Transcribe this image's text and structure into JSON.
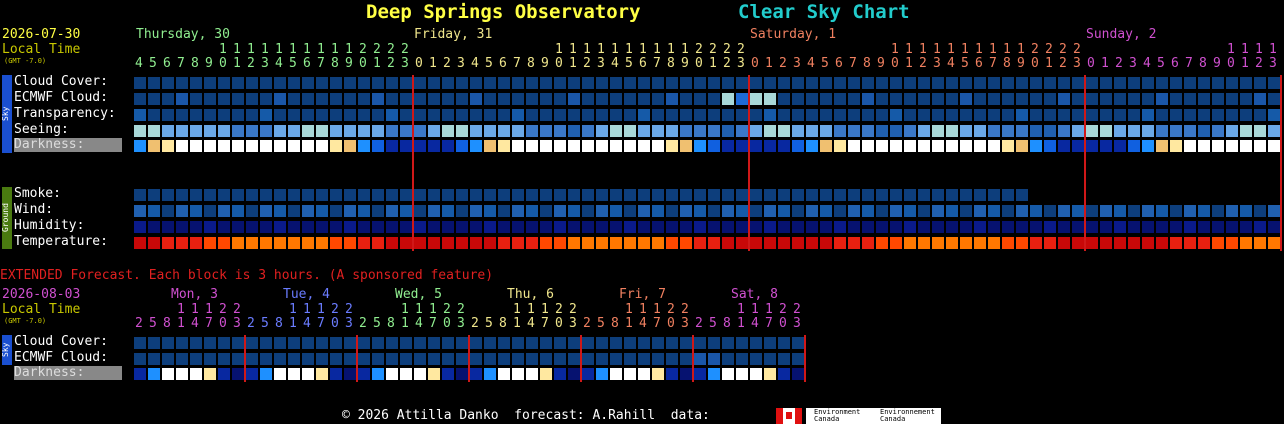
{
  "header": {
    "title": "Deep Springs Observatory",
    "subtitle": "Clear Sky Chart"
  },
  "main": {
    "date": "2026-07-30",
    "local_time": "Local Time",
    "gmt": "(GMT -7.0)",
    "days": [
      {
        "name": "Thursday, 30",
        "color": "#90ee90"
      },
      {
        "name": "Friday, 31",
        "color": "#f0e68c"
      },
      {
        "name": "Saturday, 1",
        "color": "#f08060"
      },
      {
        "name": "Sunday, 2",
        "color": "#d050d0"
      }
    ],
    "sky_rows": [
      "Cloud Cover:",
      "ECMWF Cloud:",
      "Transparency:",
      "Seeing:"
    ],
    "darkness_label": "Darkness:",
    "ground_rows": [
      "Smoke:",
      "Wind:",
      "Humidity:",
      "Temperature:"
    ],
    "sidebar_sky": "Sky",
    "sidebar_ground": "Ground"
  },
  "extended": {
    "notice": "EXTENDED Forecast. Each block is 3 hours. (A sponsored feature)",
    "date": "2026-08-03",
    "local_time": "Local Time",
    "gmt": "(GMT -7.0)",
    "days": [
      {
        "name": "Mon, 3",
        "color": "#d050d0"
      },
      {
        "name": "Tue, 4",
        "color": "#6a7cff"
      },
      {
        "name": "Wed, 5",
        "color": "#90ee90"
      },
      {
        "name": "Thu, 6",
        "color": "#f0e68c"
      },
      {
        "name": "Fri, 7",
        "color": "#f08060"
      },
      {
        "name": "Sat, 8",
        "color": "#d050d0"
      }
    ],
    "tens": "1 1 1 2 2",
    "hours": "2 5 8 1 4 7 0 3",
    "rows": [
      "Cloud Cover:",
      "ECMWF Cloud:"
    ],
    "darkness_label": "Darkness:",
    "sidebar_sky": "Sky"
  },
  "footer": {
    "copyright": "© 2026 Attilla Danko  forecast: A.Rahill  data:",
    "logo_text_1": "Environment Canada",
    "logo_text_2": "Environnement Canada"
  },
  "colors": {
    "title": "#ffff44",
    "subtitle": "#22cccc",
    "date": "#ffff44",
    "local_time": "#c8c800",
    "notice": "#e02020",
    "ext_date": "#d050d0",
    "midnight_line": "#d01818"
  }
}
